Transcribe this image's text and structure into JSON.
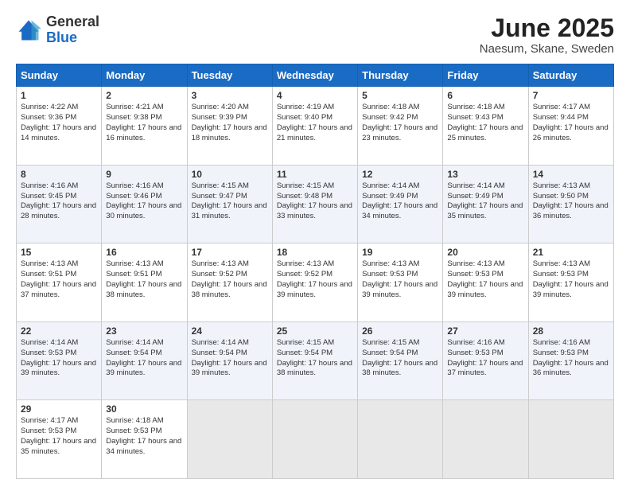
{
  "header": {
    "logo_general": "General",
    "logo_blue": "Blue",
    "title": "June 2025",
    "subtitle": "Naesum, Skane, Sweden"
  },
  "calendar": {
    "days_of_week": [
      "Sunday",
      "Monday",
      "Tuesday",
      "Wednesday",
      "Thursday",
      "Friday",
      "Saturday"
    ],
    "weeks": [
      [
        {
          "day": "1",
          "sunrise": "4:22 AM",
          "sunset": "9:36 PM",
          "daylight": "17 hours and 14 minutes."
        },
        {
          "day": "2",
          "sunrise": "4:21 AM",
          "sunset": "9:38 PM",
          "daylight": "17 hours and 16 minutes."
        },
        {
          "day": "3",
          "sunrise": "4:20 AM",
          "sunset": "9:39 PM",
          "daylight": "17 hours and 18 minutes."
        },
        {
          "day": "4",
          "sunrise": "4:19 AM",
          "sunset": "9:40 PM",
          "daylight": "17 hours and 21 minutes."
        },
        {
          "day": "5",
          "sunrise": "4:18 AM",
          "sunset": "9:42 PM",
          "daylight": "17 hours and 23 minutes."
        },
        {
          "day": "6",
          "sunrise": "4:18 AM",
          "sunset": "9:43 PM",
          "daylight": "17 hours and 25 minutes."
        },
        {
          "day": "7",
          "sunrise": "4:17 AM",
          "sunset": "9:44 PM",
          "daylight": "17 hours and 26 minutes."
        }
      ],
      [
        {
          "day": "8",
          "sunrise": "4:16 AM",
          "sunset": "9:45 PM",
          "daylight": "17 hours and 28 minutes."
        },
        {
          "day": "9",
          "sunrise": "4:16 AM",
          "sunset": "9:46 PM",
          "daylight": "17 hours and 30 minutes."
        },
        {
          "day": "10",
          "sunrise": "4:15 AM",
          "sunset": "9:47 PM",
          "daylight": "17 hours and 31 minutes."
        },
        {
          "day": "11",
          "sunrise": "4:15 AM",
          "sunset": "9:48 PM",
          "daylight": "17 hours and 33 minutes."
        },
        {
          "day": "12",
          "sunrise": "4:14 AM",
          "sunset": "9:49 PM",
          "daylight": "17 hours and 34 minutes."
        },
        {
          "day": "13",
          "sunrise": "4:14 AM",
          "sunset": "9:49 PM",
          "daylight": "17 hours and 35 minutes."
        },
        {
          "day": "14",
          "sunrise": "4:13 AM",
          "sunset": "9:50 PM",
          "daylight": "17 hours and 36 minutes."
        }
      ],
      [
        {
          "day": "15",
          "sunrise": "4:13 AM",
          "sunset": "9:51 PM",
          "daylight": "17 hours and 37 minutes."
        },
        {
          "day": "16",
          "sunrise": "4:13 AM",
          "sunset": "9:51 PM",
          "daylight": "17 hours and 38 minutes."
        },
        {
          "day": "17",
          "sunrise": "4:13 AM",
          "sunset": "9:52 PM",
          "daylight": "17 hours and 38 minutes."
        },
        {
          "day": "18",
          "sunrise": "4:13 AM",
          "sunset": "9:52 PM",
          "daylight": "17 hours and 39 minutes."
        },
        {
          "day": "19",
          "sunrise": "4:13 AM",
          "sunset": "9:53 PM",
          "daylight": "17 hours and 39 minutes."
        },
        {
          "day": "20",
          "sunrise": "4:13 AM",
          "sunset": "9:53 PM",
          "daylight": "17 hours and 39 minutes."
        },
        {
          "day": "21",
          "sunrise": "4:13 AM",
          "sunset": "9:53 PM",
          "daylight": "17 hours and 39 minutes."
        }
      ],
      [
        {
          "day": "22",
          "sunrise": "4:14 AM",
          "sunset": "9:53 PM",
          "daylight": "17 hours and 39 minutes."
        },
        {
          "day": "23",
          "sunrise": "4:14 AM",
          "sunset": "9:54 PM",
          "daylight": "17 hours and 39 minutes."
        },
        {
          "day": "24",
          "sunrise": "4:14 AM",
          "sunset": "9:54 PM",
          "daylight": "17 hours and 39 minutes."
        },
        {
          "day": "25",
          "sunrise": "4:15 AM",
          "sunset": "9:54 PM",
          "daylight": "17 hours and 38 minutes."
        },
        {
          "day": "26",
          "sunrise": "4:15 AM",
          "sunset": "9:54 PM",
          "daylight": "17 hours and 38 minutes."
        },
        {
          "day": "27",
          "sunrise": "4:16 AM",
          "sunset": "9:53 PM",
          "daylight": "17 hours and 37 minutes."
        },
        {
          "day": "28",
          "sunrise": "4:16 AM",
          "sunset": "9:53 PM",
          "daylight": "17 hours and 36 minutes."
        }
      ],
      [
        {
          "day": "29",
          "sunrise": "4:17 AM",
          "sunset": "9:53 PM",
          "daylight": "17 hours and 35 minutes."
        },
        {
          "day": "30",
          "sunrise": "4:18 AM",
          "sunset": "9:53 PM",
          "daylight": "17 hours and 34 minutes."
        },
        null,
        null,
        null,
        null,
        null
      ]
    ],
    "cell_labels": {
      "sunrise": "Sunrise:",
      "sunset": "Sunset:",
      "daylight": "Daylight:"
    }
  }
}
